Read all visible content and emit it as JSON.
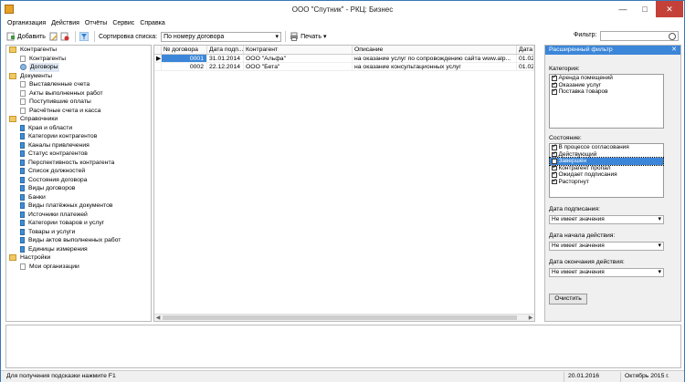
{
  "window": {
    "title": "ООО \"Спутник\" - РКЦ: Бизнес"
  },
  "menu": [
    "Организация",
    "Действия",
    "Отчёты",
    "Сервис",
    "Справка"
  ],
  "toolbar": {
    "add_label": "Добавить",
    "sort_label": "Сортировка списка:",
    "sort_value": "По номеру договора",
    "print_label": "Печать",
    "filter_label": "Фильтр:",
    "filter_value": ""
  },
  "tree": {
    "groups": [
      {
        "label": "Контрагенты",
        "items": [
          {
            "label": "Контрагенты",
            "selected": false
          },
          {
            "label": "Договоры",
            "selected": true
          }
        ]
      },
      {
        "label": "Документы",
        "items": [
          {
            "label": "Выставленные счета"
          },
          {
            "label": "Акты выполненных работ"
          },
          {
            "label": "Поступившие оплаты"
          },
          {
            "label": "Расчётные счета и касса"
          }
        ]
      },
      {
        "label": "Справочники",
        "items": [
          {
            "label": "Края и области"
          },
          {
            "label": "Категории контрагентов"
          },
          {
            "label": "Каналы привлечения"
          },
          {
            "label": "Статус контрагентов"
          },
          {
            "label": "Перспективность контрагента"
          },
          {
            "label": "Список должностей"
          },
          {
            "label": "Состояния договора"
          },
          {
            "label": "Виды договоров"
          },
          {
            "label": "Банки"
          },
          {
            "label": "Виды платёжных документов"
          },
          {
            "label": "Источники платежей"
          },
          {
            "label": "Категории товаров и услуг"
          },
          {
            "label": "Товары и услуги"
          },
          {
            "label": "Виды актов выполненных работ"
          },
          {
            "label": "Единицы измерения"
          }
        ]
      },
      {
        "label": "Настройки",
        "items": [
          {
            "label": "Мои организации"
          }
        ]
      }
    ]
  },
  "grid": {
    "columns": [
      "№ договора",
      "Дата подп...",
      "Контрагент",
      "Описание",
      "Дата н"
    ],
    "rows": [
      {
        "num": "0001",
        "date": "31.01.2014",
        "party": "ООО \"Альфа\"",
        "desc": "на оказание услуг по сопровождению сайта www.alp...",
        "start": "01.02",
        "selected": true
      },
      {
        "num": "0002",
        "date": "22.12.2014",
        "party": "ООО \"Бета\"",
        "desc": "на оказание консультационных услуг",
        "start": "01.02",
        "selected": false
      }
    ]
  },
  "filter_panel": {
    "title": "Расширенный фильтр",
    "category_label": "Категория:",
    "categories": [
      {
        "label": "Аренда помещений",
        "checked": true
      },
      {
        "label": "Оказание услуг",
        "checked": true
      },
      {
        "label": "Поставка товаров",
        "checked": true
      }
    ],
    "state_label": "Состояние:",
    "states": [
      {
        "label": "В процессе согласования",
        "checked": true
      },
      {
        "label": "Действующий",
        "checked": true
      },
      {
        "label": "Завершён",
        "checked": false,
        "highlighted": true
      },
      {
        "label": "Контрагент пропал",
        "checked": true
      },
      {
        "label": "Ожидает подписания",
        "checked": true
      },
      {
        "label": "Расторгнут",
        "checked": true
      }
    ],
    "sign_date_label": "Дата подписания:",
    "sign_date_value": "Не имеет значения",
    "start_date_label": "Дата начала действия:",
    "start_date_value": "Не имеет значения",
    "end_date_label": "Дата окончания действия:",
    "end_date_value": "Не имеет значения",
    "clear_label": "Очистить"
  },
  "status": {
    "hint": "Для получения подсказки нажмите F1",
    "date": "20.01.2016",
    "month": "Октябрь 2015 г."
  }
}
